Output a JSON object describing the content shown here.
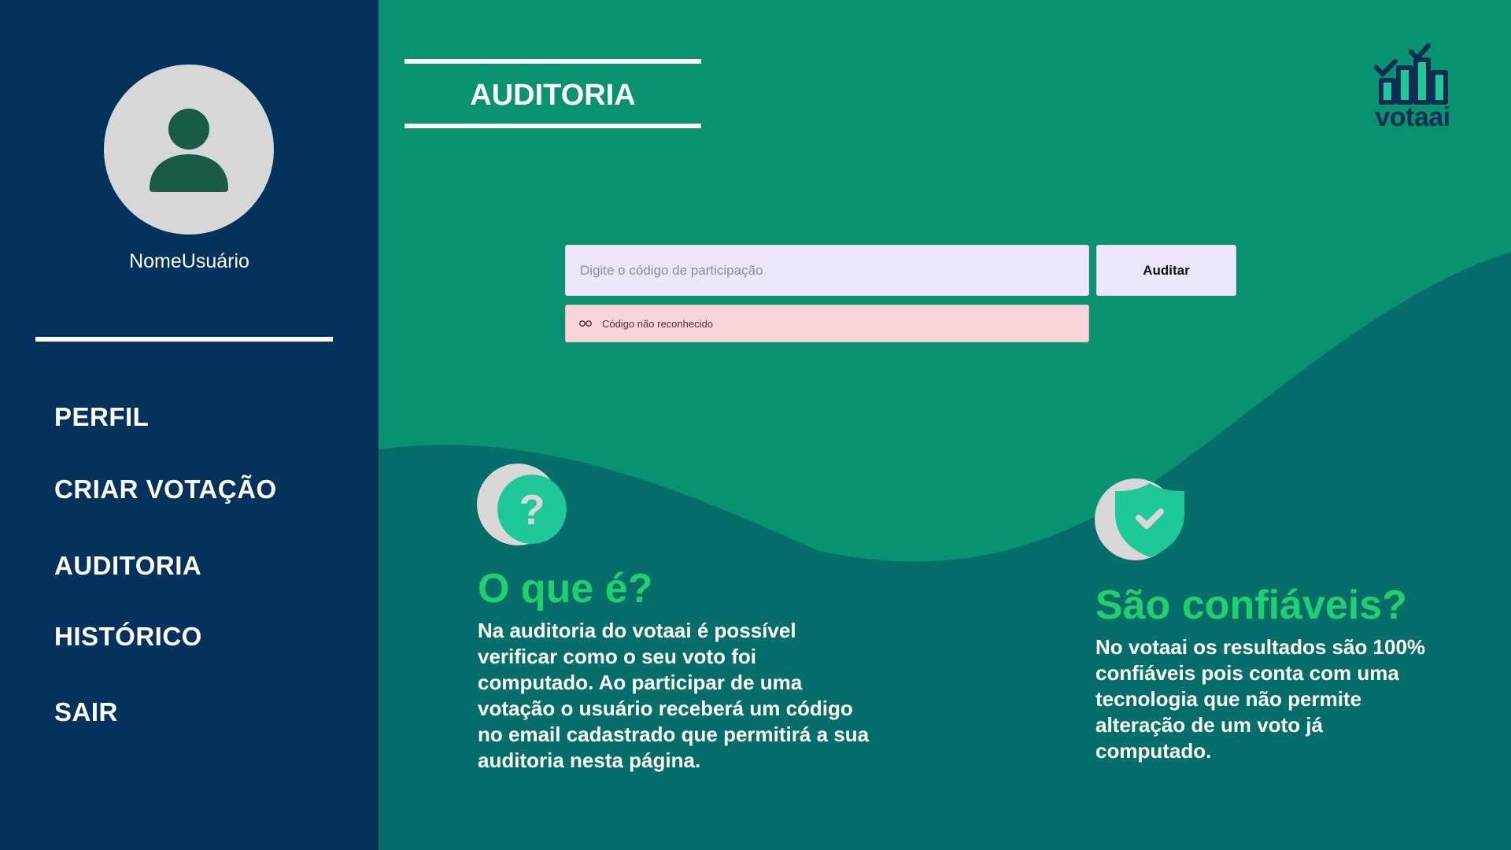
{
  "sidebar": {
    "username": "NomeUsuário",
    "nav": [
      "PERFIL",
      "CRIAR VOTAÇÃO",
      "AUDITORIA",
      "HISTÓRICO",
      "SAIR"
    ]
  },
  "header": {
    "title": "AUDITORIA",
    "logo_text": "votaai"
  },
  "audit_form": {
    "placeholder": "Digite o código de participação",
    "value": "",
    "button_label": "Auditar",
    "error_message": "Código não reconhecido"
  },
  "info": {
    "what": {
      "icon": "question-icon",
      "title": "O que é?",
      "text": "Na auditoria do votaai é possível verificar como o seu voto foi computado. Ao participar de uma votação o usuário receberá um código no email cadastrado que permitirá a sua auditoria nesta página."
    },
    "trust": {
      "icon": "shield-check-icon",
      "title": "São confiáveis?",
      "text": "No votaai os resultados são 100% confiáveis pois conta com uma tecnologia que não permite alteração de um voto já computado."
    }
  },
  "colors": {
    "sidebar": "#03325d",
    "main_bg": "#08926f",
    "wave": "#066e6a",
    "heading_green": "#20d06c",
    "accent_teal": "#1ec997",
    "error_bg": "#f7d6da",
    "input_bg": "#ebe6fb"
  }
}
